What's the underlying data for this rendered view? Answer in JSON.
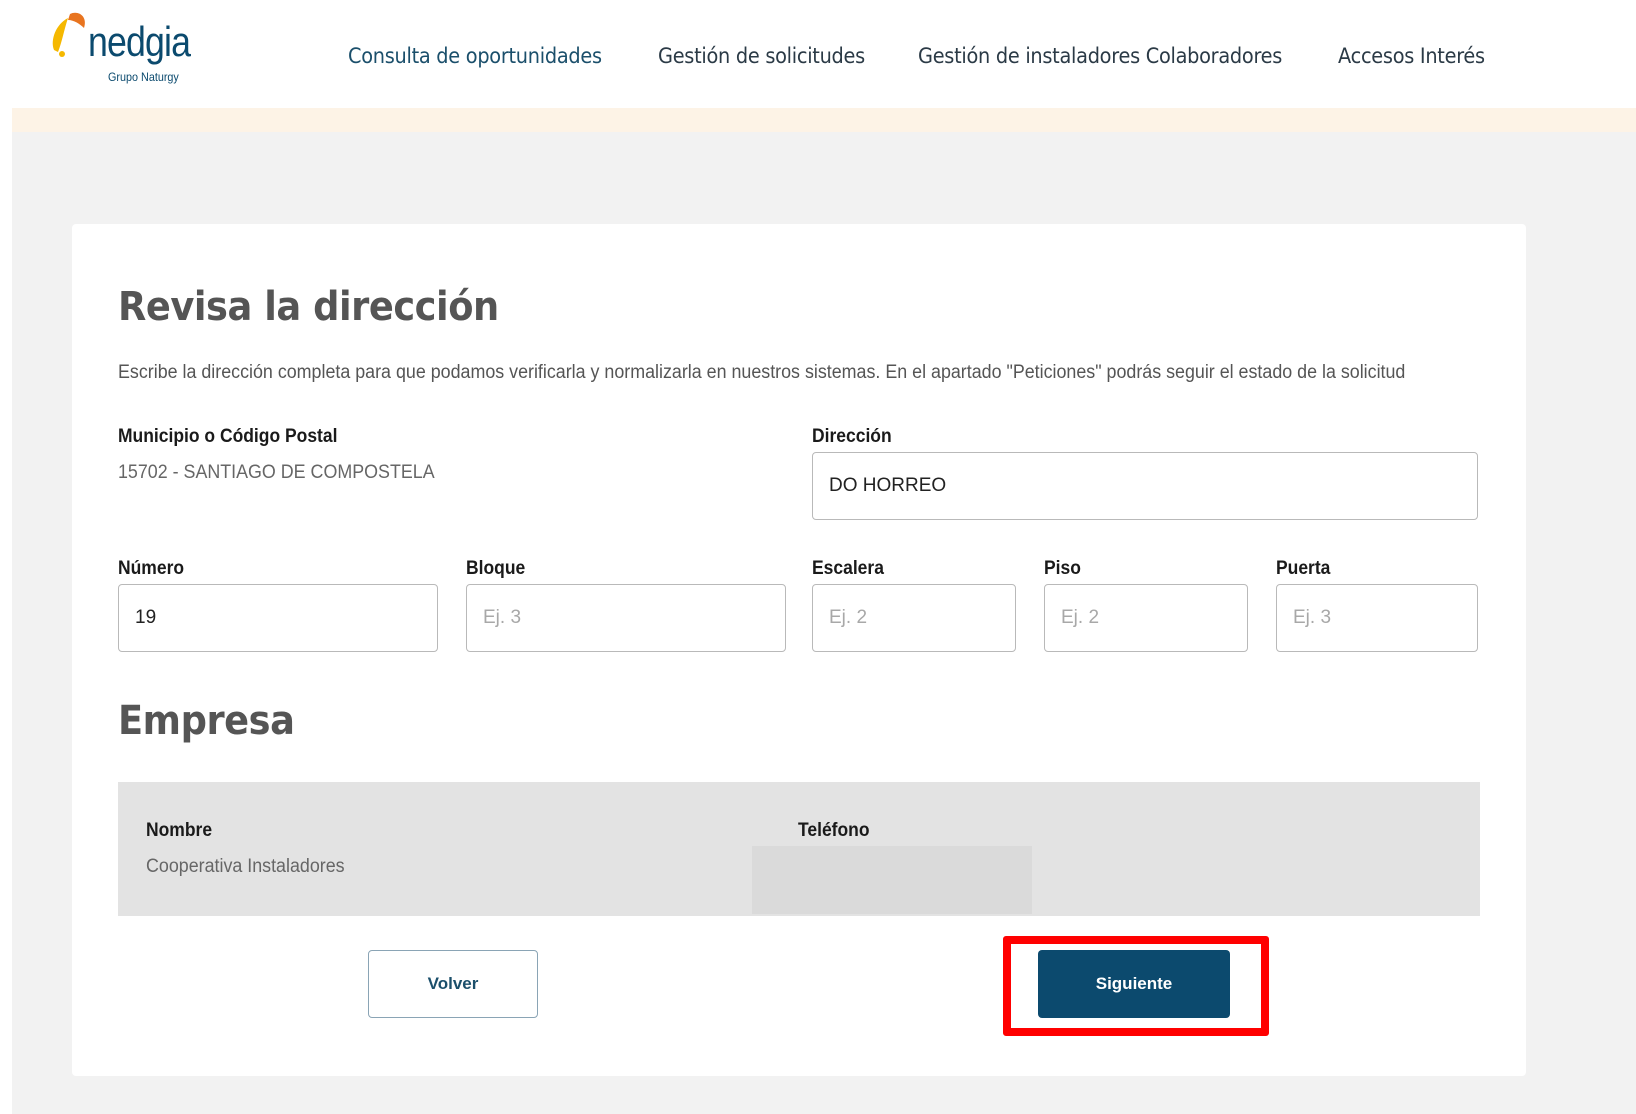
{
  "brand": {
    "name": "nedgia",
    "subtitle": "Grupo Naturgy",
    "colors": {
      "primary": "#0c4a6e",
      "accent_yellow": "#f5b800",
      "accent_orange": "#e8741f"
    }
  },
  "nav": {
    "items": [
      {
        "label": "Consulta de oportunidades"
      },
      {
        "label": "Gestión de solicitudes"
      },
      {
        "label": "Gestión de instaladores Colaboradores"
      },
      {
        "label": "Accesos Interés"
      }
    ]
  },
  "form": {
    "title": "Revisa la dirección",
    "description": "Escribe la dirección completa para que podamos verificarla y normalizarla en nuestros sistemas. En el apartado \"Peticiones\" podrás seguir el estado de la solicitud",
    "municipio": {
      "label": "Municipio o Código Postal",
      "value": "15702 - SANTIAGO DE COMPOSTELA"
    },
    "direccion": {
      "label": "Dirección",
      "value": "DO HORREO"
    },
    "numero": {
      "label": "Número",
      "value": "19"
    },
    "bloque": {
      "label": "Bloque",
      "placeholder": "Ej. 3"
    },
    "escalera": {
      "label": "Escalera",
      "placeholder": "Ej. 2"
    },
    "piso": {
      "label": "Piso",
      "placeholder": "Ej. 2"
    },
    "puerta": {
      "label": "Puerta",
      "placeholder": "Ej. 3"
    }
  },
  "empresa": {
    "title": "Empresa",
    "nombre": {
      "label": "Nombre",
      "value": "Cooperativa Instaladores"
    },
    "telefono": {
      "label": "Teléfono"
    }
  },
  "actions": {
    "back_label": "Volver",
    "next_label": "Siguiente"
  }
}
